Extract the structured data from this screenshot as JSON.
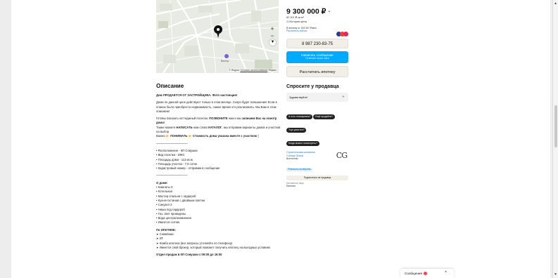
{
  "price": {
    "value": "9 300 000 ₽",
    "per_m2": "82 301 ₽ за м²",
    "history": "История цены"
  },
  "mortgage": {
    "text": "В ипотеку от 153 067 ₽/мес.",
    "link": "Рассчитать сейчас",
    "bank_colors": [
      "#1e3fa0",
      "#ff3b30",
      "#e8265e"
    ]
  },
  "buttons": {
    "phone": "8 987 230-83-75",
    "message": "Написать сообщение",
    "message_sub": "Отвечает около часа",
    "mortgage_calc": "Рассчитать ипотеку"
  },
  "ask": {
    "title": "Спросите у продавца",
    "input_value": "Здравствуйте!",
    "chips": [
      "А есть планировка?",
      "Ещё продаёте?",
      "Торг уместен?",
      "Когда можно посмотреть?"
    ]
  },
  "seller": {
    "name": "Строительная компания",
    "name2": "Солнце Global",
    "agency": "Агентство",
    "verified": "Реквизиты проверены",
    "logo": "CG",
    "subscribe": "Подписаться на продавца",
    "contact_label": "Контактное лицо",
    "contact_name": "Евгения"
  },
  "map": {
    "attribution": "© Яндекс",
    "attribution_link": "Условия использования",
    "brand": "Яндекс",
    "poi_label": "Вектор",
    "zoom_in": "+",
    "zoom_out": "−"
  },
  "description": {
    "title": "Описание",
    "p1": "Дом ПРОДАЕТСЯ ОТ ЗАСТРОЙЩИКА. Фото настоящие!",
    "p2": "Дома по данной цене действуют только в этом месяце. Скоро будет повышение! Если в планах было приобрести недвижимость, самое время это реализовать. Мы Вам в этом поможем!",
    "p3a": "Готовы показать коттеджный поселок. ",
    "p3b": "ПОЗВОНИТЕ",
    "p3c": " нам и мы ",
    "p3d": "запишем Вас на осмотр дома!",
    "p3e": "Также можете ",
    "p3f": "НАПИСАТЬ",
    "p3g": " нам слово ",
    "p3h": "КАТАЛОГ",
    "p3i": ", мы отправим варианты домов и участков на выбор",
    "p3j": "Важно ",
    "p3k": "👉 ПОНИМАТЬ 👉 Стоимость дома указана вместе с участком❗",
    "sep": "〰〰〰〰〰〰〰〰〰〰〰〰",
    "list1": [
      "• Расположение - КП Совушки",
      "• Вид поселка - ИЖС",
      "• Площадь дома - 113 кв.м",
      "• Площадь участка - 7,5 соток",
      "• Кадастровый номер - отправим в сообщение"
    ],
    "house_title": "О доме:",
    "house": [
      "• Комнаты 3",
      "• Котельная",
      "• Мастер спальня с гардероб",
      "• Кухня-гостиная с двойным светом",
      "• Санузел 2",
      "• Ниша под гардероб",
      "• Газ, свет проведены",
      "• Вода централизованная",
      "• Имеется септик"
    ],
    "mort_title": "По ИПОТЕКЕ:",
    "mort": [
      "➤ Семейная",
      "➤ ИТ",
      "➤ Комбо ипотека (все вопросы уточняйте по телефону)",
      "➤ Имеется свой брокер, который поможет получить ипотеку на выгодных условиях"
    ],
    "office": "Отдел продаж в КП Совушки с 09:00 до 16:00"
  },
  "messages_widget": {
    "label": "Сообщения",
    "caret": "^"
  }
}
